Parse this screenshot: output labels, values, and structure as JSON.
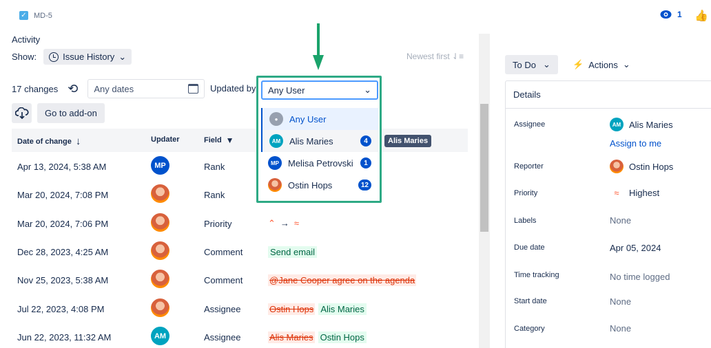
{
  "issue": {
    "key": "MD-5"
  },
  "watch": {
    "count": "1"
  },
  "activity": {
    "title": "Activity",
    "show_label": "Show:",
    "show_value": "Issue History",
    "sort_label": "Newest first",
    "changes_count": "17 changes",
    "dates_placeholder": "Any dates",
    "updated_by_label": "Updated by:",
    "updated_by_value": "Any User",
    "addon_button": "Go to add-on"
  },
  "table": {
    "headers": {
      "date": "Date of change",
      "updater": "Updater",
      "field": "Field"
    },
    "rows": [
      {
        "date": "Apr 13, 2024, 5:38 AM",
        "updater_initials": "MP",
        "field": "Rank"
      },
      {
        "date": "Mar 20, 2024, 7:08 PM",
        "field": "Rank"
      },
      {
        "date": "Mar 20, 2024, 7:06 PM",
        "field": "Priority"
      },
      {
        "date": "Dec 28, 2023, 4:25 AM",
        "field": "Comment",
        "new_value": "Send email"
      },
      {
        "date": "Nov 25, 2023, 5:38 AM",
        "field": "Comment",
        "old_value": "@Jane Cooper agree on the agenda"
      },
      {
        "date": "Jul 22, 2023, 4:08 PM",
        "field": "Assignee",
        "old_value": "Ostin Hops",
        "new_value": "Alis Maries"
      },
      {
        "date": "Jun 22, 2023, 11:32 AM",
        "updater_initials": "AM",
        "field": "Assignee",
        "old_value": "Alis Maries",
        "new_value": "Ostin Hops"
      }
    ]
  },
  "user_menu": [
    {
      "label": "Any User"
    },
    {
      "label": "Alis Maries",
      "initials": "AM",
      "count": "4"
    },
    {
      "label": "Melisa Petrovski",
      "initials": "MP",
      "count": "1"
    },
    {
      "label": "Ostin Hops",
      "count": "12"
    }
  ],
  "tooltip": "Alis Maries",
  "side": {
    "status": "To Do",
    "actions": "Actions",
    "details_title": "Details",
    "assignee_label": "Assignee",
    "assignee_initials": "AM",
    "assignee_value": "Alis Maries",
    "assign_to_me": "Assign to me",
    "reporter_label": "Reporter",
    "reporter_value": "Ostin Hops",
    "priority_label": "Priority",
    "priority_value": "Highest",
    "labels_label": "Labels",
    "labels_value": "None",
    "due_label": "Due date",
    "due_value": "Apr 05, 2024",
    "time_label": "Time tracking",
    "time_value": "No time logged",
    "start_label": "Start date",
    "start_value": "None",
    "category_label": "Category",
    "category_value": "None"
  }
}
